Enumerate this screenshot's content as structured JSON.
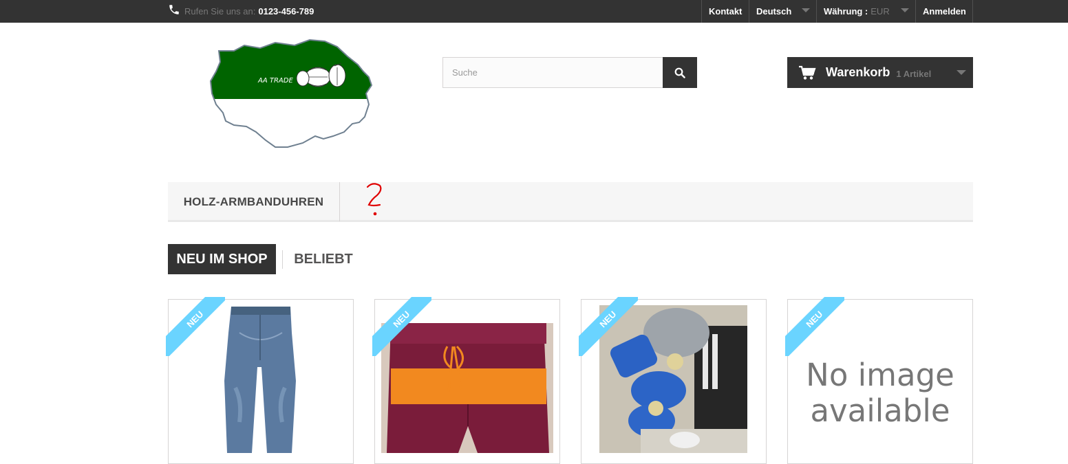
{
  "topbar": {
    "phone_prefix": "Rufen Sie uns an:",
    "phone_number": "0123-456-789",
    "contact": "Kontakt",
    "language": "Deutsch",
    "currency_label": "Währung :",
    "currency_value": "EUR",
    "login": "Anmelden"
  },
  "logo": {
    "text": "AA TRADE"
  },
  "search": {
    "placeholder": "Suche"
  },
  "cart": {
    "label": "Warenkorb",
    "count": "1 Artikel"
  },
  "menu": {
    "items": [
      {
        "label": "HOLZ-ARMBANDUHREN"
      }
    ],
    "annotation": "?"
  },
  "tabs": {
    "active": "NEU IM SHOP",
    "inactive": "BELIEBT"
  },
  "products": [
    {
      "badge": "NEU",
      "image": "jeans"
    },
    {
      "badge": "NEU",
      "image": "board-shorts"
    },
    {
      "badge": "NEU",
      "image": "baby-set"
    },
    {
      "badge": "NEU",
      "image": "none",
      "placeholder": "No image available"
    }
  ],
  "colors": {
    "topbar": "#333333",
    "ribbon": "#6ad4ff",
    "logo_green": "#006400",
    "annotation_red": "#e00000"
  }
}
